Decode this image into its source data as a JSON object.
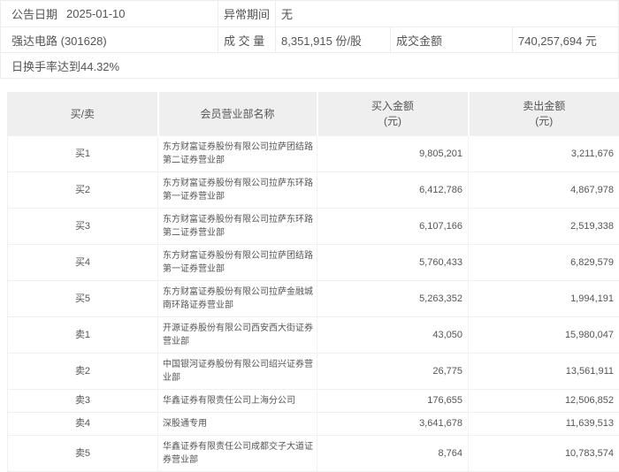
{
  "info": {
    "announce_date_label": "公告日期",
    "announce_date": "2025-01-10",
    "abnormal_period_label": "异常期间",
    "abnormal_period": "无",
    "stock_title": "强达电路 (301628)",
    "volume_label": "成 交 量",
    "volume_value": "8,351,915 份/股",
    "amount_label": "成交金额",
    "amount_value": "740,257,694 元",
    "turnover_note": "日换手率达到44.32%"
  },
  "table": {
    "headers": {
      "side": "买/卖",
      "name": "会员营业部名称",
      "buy": "买入金额",
      "sell": "卖出金额",
      "unit": "(元)"
    },
    "rows": [
      {
        "side": "买1",
        "name": "东方财富证券股份有限公司拉萨团结路第二证券营业部",
        "buy": "9,805,201",
        "sell": "3,211,676"
      },
      {
        "side": "买2",
        "name": "东方财富证券股份有限公司拉萨东环路第一证券营业部",
        "buy": "6,412,786",
        "sell": "4,867,978"
      },
      {
        "side": "买3",
        "name": "东方财富证券股份有限公司拉萨东环路第二证券营业部",
        "buy": "6,107,166",
        "sell": "2,519,338"
      },
      {
        "side": "买4",
        "name": "东方财富证券股份有限公司拉萨团结路第一证券营业部",
        "buy": "5,760,433",
        "sell": "6,829,579"
      },
      {
        "side": "买5",
        "name": "东方财富证券股份有限公司拉萨金融城南环路证券营业部",
        "buy": "5,263,352",
        "sell": "1,994,191"
      },
      {
        "side": "卖1",
        "name": "开源证券股份有限公司西安西大街证券营业部",
        "buy": "43,050",
        "sell": "15,980,047"
      },
      {
        "side": "卖2",
        "name": "中国银河证券股份有限公司绍兴证券营业部",
        "buy": "26,775",
        "sell": "13,561,911"
      },
      {
        "side": "卖3",
        "name": "华鑫证券有限责任公司上海分公司",
        "buy": "176,655",
        "sell": "12,506,852"
      },
      {
        "side": "卖4",
        "name": "深股通专用",
        "buy": "3,641,678",
        "sell": "11,639,513"
      },
      {
        "side": "卖5",
        "name": "华鑫证券有限责任公司成都交子大道证券营业部",
        "buy": "8,764",
        "sell": "10,783,574"
      }
    ],
    "colors": {
      "header_bg": "#efefef",
      "panel_border": "#ececec",
      "row_border": "#f0f0f0",
      "text": "#555555"
    }
  }
}
